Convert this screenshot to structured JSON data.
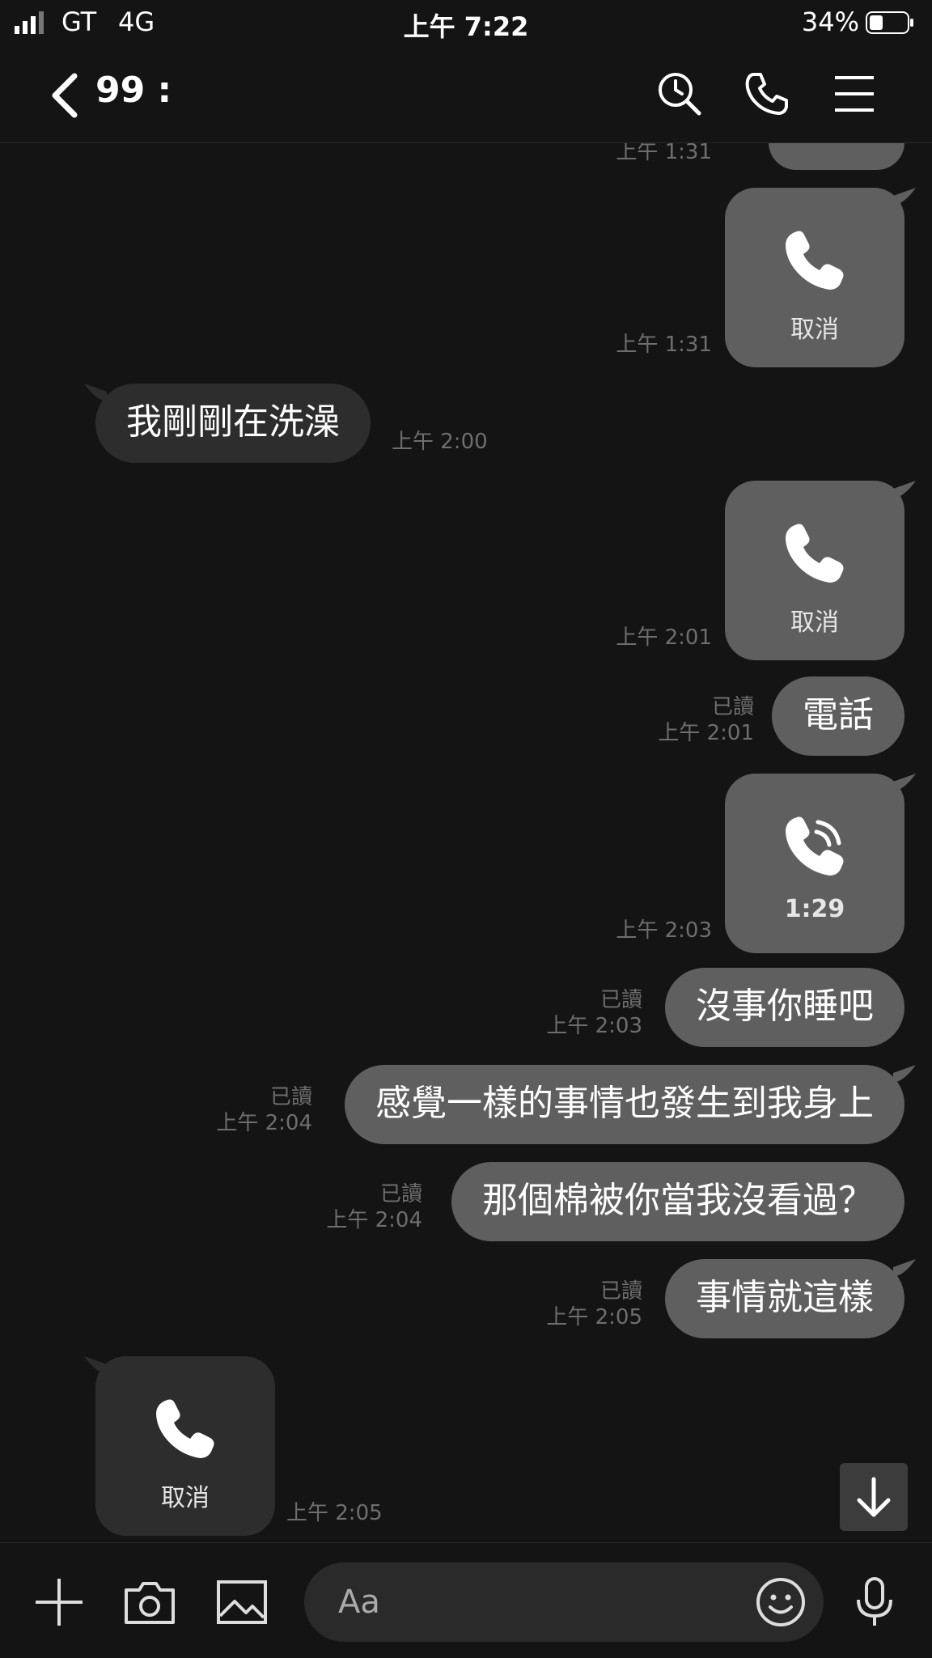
{
  "status_bar": {
    "carrier": "GT",
    "network": "4G",
    "time": "上午 7:22",
    "battery": "34%",
    "battery_level": 0.34
  },
  "header": {
    "title": "99 :",
    "icons": [
      "back-icon",
      "search-clock-icon",
      "phone-icon",
      "menu-icon"
    ]
  },
  "messages": [
    {
      "dir": "out",
      "type": "call",
      "label": "",
      "time": "上午 1:31"
    },
    {
      "dir": "out",
      "type": "call",
      "label": "取消",
      "time": "上午 1:31"
    },
    {
      "dir": "in",
      "type": "text",
      "text": "我剛剛在洗澡",
      "time": "上午 2:00"
    },
    {
      "dir": "out",
      "type": "call",
      "label": "取消",
      "time": "上午 2:01"
    },
    {
      "dir": "out",
      "type": "text",
      "text": "電話",
      "read": "已讀",
      "time": "上午 2:01"
    },
    {
      "dir": "out",
      "type": "call-ended",
      "label": "1:29",
      "time": "上午 2:03"
    },
    {
      "dir": "out",
      "type": "text",
      "text": "沒事你睡吧",
      "read": "已讀",
      "time": "上午 2:03"
    },
    {
      "dir": "out",
      "type": "text",
      "text": "感覺一樣的事情也發生到我身上",
      "read": "已讀",
      "time": "上午 2:04"
    },
    {
      "dir": "out",
      "type": "text",
      "text": "那個棉被你當我沒看過？",
      "read": "已讀",
      "time": "上午 2:04"
    },
    {
      "dir": "out",
      "type": "text",
      "text": "事情就這樣",
      "read": "已讀",
      "time": "上午 2:05"
    },
    {
      "dir": "in",
      "type": "call",
      "label": "取消",
      "time": "上午 2:05"
    }
  ],
  "composer": {
    "placeholder": "Aa",
    "icons": [
      "plus-icon",
      "camera-icon",
      "image-icon",
      "emoji-icon",
      "microphone-icon"
    ]
  },
  "colors": {
    "background": "#141414",
    "bubble_out": "#5f5f5f",
    "bubble_in": "#2d2d2d",
    "meta_text": "#6e6e6e"
  }
}
